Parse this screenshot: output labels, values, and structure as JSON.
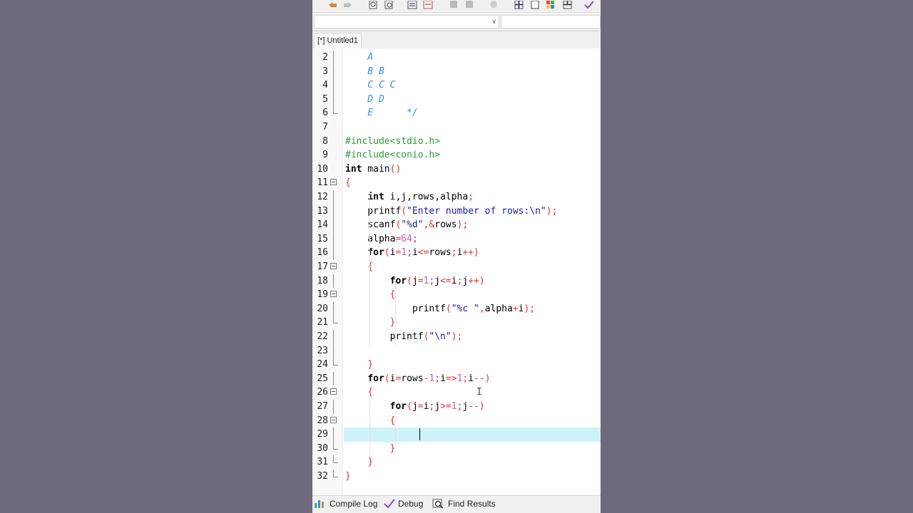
{
  "tab": {
    "label": "[*] Untitled1"
  },
  "editor": {
    "lines": [
      {
        "n": "2",
        "code": "<span style=\"color:#3a8fd8;font-style:italic\">    A</span>",
        "fold": "line"
      },
      {
        "n": "3",
        "code": "<span style=\"color:#3a8fd8;font-style:italic\">    B B</span>",
        "fold": "line"
      },
      {
        "n": "4",
        "code": "<span style=\"color:#3a8fd8;font-style:italic\">    C C C</span>",
        "fold": "line"
      },
      {
        "n": "5",
        "code": "<span style=\"color:#3a8fd8;font-style:italic\">    D D</span>",
        "fold": "line"
      },
      {
        "n": "6",
        "code": "<span style=\"color:#3a8fd8;font-style:italic\">    E      */</span>",
        "fold": "end"
      },
      {
        "n": "7",
        "code": "",
        "fold": ""
      },
      {
        "n": "8",
        "code": "<span style=\"color:#2e9a3c\">#include&lt;stdio.h&gt;</span>",
        "fold": ""
      },
      {
        "n": "9",
        "code": "<span style=\"color:#2e9a3c\">#include&lt;conio.h&gt;</span>",
        "fold": ""
      },
      {
        "n": "10",
        "code": "<b>int</b> main<span style=\"color:#d33\">()</span>",
        "fold": ""
      },
      {
        "n": "11",
        "code": "<span style=\"color:#d33\">{</span>",
        "fold": "box"
      },
      {
        "n": "12",
        "code": "    <b>int</b> i,j,rows,alpha<span style=\"color:#d33\">;</span>",
        "fold": "line"
      },
      {
        "n": "13",
        "code": "    printf<span style=\"color:#d33\">(</span><span style=\"color:#1a1aa6\">\"Enter number of rows:\\n\"</span><span style=\"color:#d33\">);</span>",
        "fold": "line"
      },
      {
        "n": "14",
        "code": "    scanf<span style=\"color:#d33\">(</span><span style=\"color:#1a1aa6\">\"%d\"</span><span style=\"color:#d33\">,&amp;</span>rows<span style=\"color:#d33\">);</span>",
        "fold": "line"
      },
      {
        "n": "15",
        "code": "    alpha<span style=\"color:#d33\">=</span><span style=\"color:#c060c0\">64</span><span style=\"color:#d33\">;</span>",
        "fold": "line"
      },
      {
        "n": "16",
        "code": "    <b>for</b><span style=\"color:#d33\">(</span>i<span style=\"color:#d33\">=</span><span style=\"color:#c060c0\">1</span><span style=\"color:#d33\">;</span>i<span style=\"color:#d33\">&lt;=</span>rows<span style=\"color:#d33\">;</span>i<span style=\"color:#d33\">++)</span>",
        "fold": "line"
      },
      {
        "n": "17",
        "code": "    <span style=\"color:#d33\">{</span>",
        "fold": "box"
      },
      {
        "n": "18",
        "code": "        <b>for</b><span style=\"color:#d33\">(</span>j<span style=\"color:#d33\">=</span><span style=\"color:#c060c0\">1</span><span style=\"color:#d33\">;</span>j<span style=\"color:#d33\">&lt;=</span>i<span style=\"color:#d33\">;</span>j<span style=\"color:#d33\">++)</span>",
        "fold": "line"
      },
      {
        "n": "19",
        "code": "        <span style=\"color:#d33\">{</span>",
        "fold": "box"
      },
      {
        "n": "20",
        "code": "            printf<span style=\"color:#d33\">(</span><span style=\"color:#1a1aa6\">\"%c \"</span><span style=\"color:#d33\">,</span>alpha<span style=\"color:#d33\">+</span>i<span style=\"color:#d33\">);</span>",
        "fold": "line"
      },
      {
        "n": "21",
        "code": "        <span style=\"color:#d33\">}</span>",
        "fold": "end"
      },
      {
        "n": "22",
        "code": "        printf<span style=\"color:#d33\">(</span><span style=\"color:#1a1aa6\">\"\\n\"</span><span style=\"color:#d33\">);</span>",
        "fold": "line"
      },
      {
        "n": "23",
        "code": "",
        "fold": "line"
      },
      {
        "n": "24",
        "code": "    <span style=\"color:#d33\">}</span>",
        "fold": "end"
      },
      {
        "n": "25",
        "code": "    <b>for</b><span style=\"color:#d33\">(</span>i<span style=\"color:#d33\">=</span>rows<span style=\"color:#d33\">-</span><span style=\"color:#c060c0\">1</span><span style=\"color:#d33\">;</span>i<span style=\"color:#d33\">=&gt;</span><span style=\"color:#c060c0\">1</span><span style=\"color:#d33\">;</span>i<span style=\"color:#d33\">--)</span>",
        "fold": "line"
      },
      {
        "n": "26",
        "code": "    <span style=\"color:#d33\">{</span>",
        "fold": "box"
      },
      {
        "n": "27",
        "code": "        <b>for</b><span style=\"color:#d33\">(</span>j<span style=\"color:#d33\">=</span>i<span style=\"color:#d33\">;</span>j<span style=\"color:#d33\">&gt;=</span><span style=\"color:#c060c0\">1</span><span style=\"color:#d33\">;</span>j<span style=\"color:#d33\">--)</span>",
        "fold": "line"
      },
      {
        "n": "28",
        "code": "        <span style=\"color:#d33\">{</span>",
        "fold": "box"
      },
      {
        "n": "29",
        "code": "",
        "fold": "line",
        "current": true
      },
      {
        "n": "30",
        "code": "        <span style=\"color:#d33\">}</span>",
        "fold": "end"
      },
      {
        "n": "31",
        "code": "    <span style=\"color:#d33\">}</span>",
        "fold": "end"
      },
      {
        "n": "32",
        "code": "<span style=\"color:#d33\">}</span>",
        "fold": "end"
      }
    ]
  },
  "statusbar": {
    "compile_log": "Compile Log",
    "debug": "Debug",
    "find_results": "Find Results"
  },
  "colors": {
    "background": "#6e6a7b",
    "current_line": "#cdf3f9",
    "comment": "#3a8fd8",
    "preprocessor": "#2e9a3c",
    "string": "#1a1aa6",
    "symbol": "#dd3333",
    "number": "#c060c0"
  },
  "icons": [
    "toolbar-icon",
    "compile-log-icon",
    "debug-check-icon",
    "find-results-icon"
  ]
}
